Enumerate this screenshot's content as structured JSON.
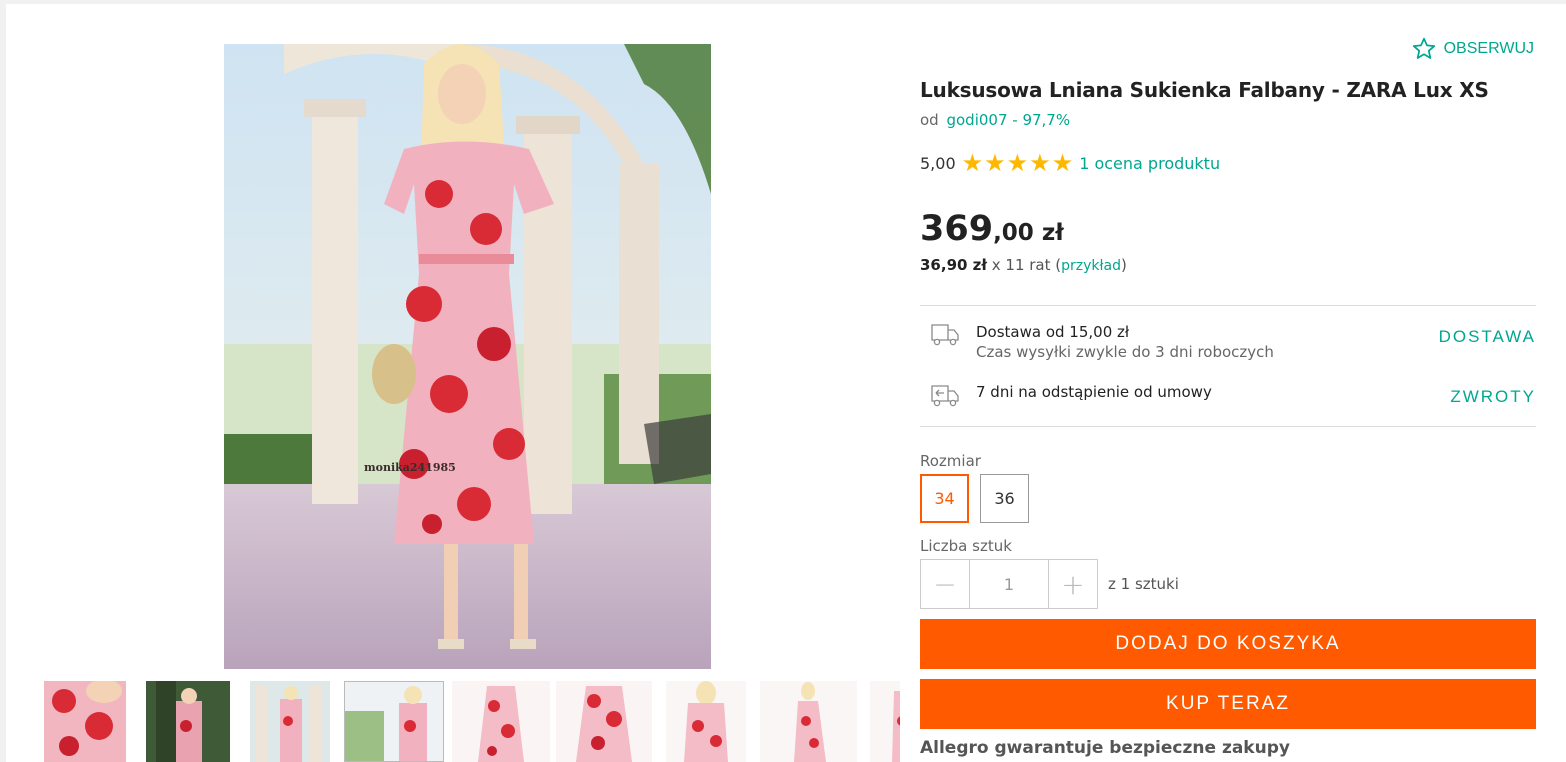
{
  "gallery": {
    "watermark": "monika241985",
    "thumbs": [
      {
        "name": "thumbnail-1"
      },
      {
        "name": "thumbnail-2"
      },
      {
        "name": "thumbnail-3"
      },
      {
        "name": "thumbnail-4"
      },
      {
        "name": "thumbnail-5"
      },
      {
        "name": "thumbnail-6"
      },
      {
        "name": "thumbnail-7"
      },
      {
        "name": "thumbnail-8"
      },
      {
        "name": "thumbnail-9"
      }
    ]
  },
  "product": {
    "follow_label": "OBSERWUJ",
    "follow_icon": "star-outline-icon",
    "title": "Luksusowa Lniana Sukienka Falbany - ZARA Lux XS",
    "seller_prefix": "od",
    "seller": "godi007 - 97,7%",
    "rating_value": "5,00",
    "rating_stars": 5,
    "rating_link": "1 ocena produktu",
    "price_int": "369",
    "price_dec": ",00 zł",
    "installment_amount": "36,90 zł",
    "installment_count": "x 11 rat",
    "installment_open": "(",
    "installment_link": "przykład",
    "installment_close": ")"
  },
  "delivery": {
    "icon": "delivery-truck-icon",
    "title": "Dostawa od 15,00 zł",
    "subtitle": "Czas wysyłki zwykle do 3 dni roboczych",
    "link": "DOSTAWA"
  },
  "returns": {
    "icon": "return-truck-icon",
    "title": "7 dni na odstąpienie od umowy",
    "link": "ZWROTY"
  },
  "size": {
    "label": "Rozmiar",
    "options": [
      "34",
      "36"
    ],
    "selected": "34"
  },
  "quantity": {
    "label": "Liczba sztuk",
    "value": "1",
    "minus": "−",
    "plus": "+",
    "available": "z 1 sztuki"
  },
  "actions": {
    "add_to_cart": "DODAJ DO KOSZYKA",
    "buy_now": "KUP TERAZ"
  },
  "guarantee": "Allegro gwarantuje bezpieczne zakupy",
  "colors": {
    "accent": "#00a790",
    "cta": "#ff5a00",
    "star": "#ffb800"
  }
}
